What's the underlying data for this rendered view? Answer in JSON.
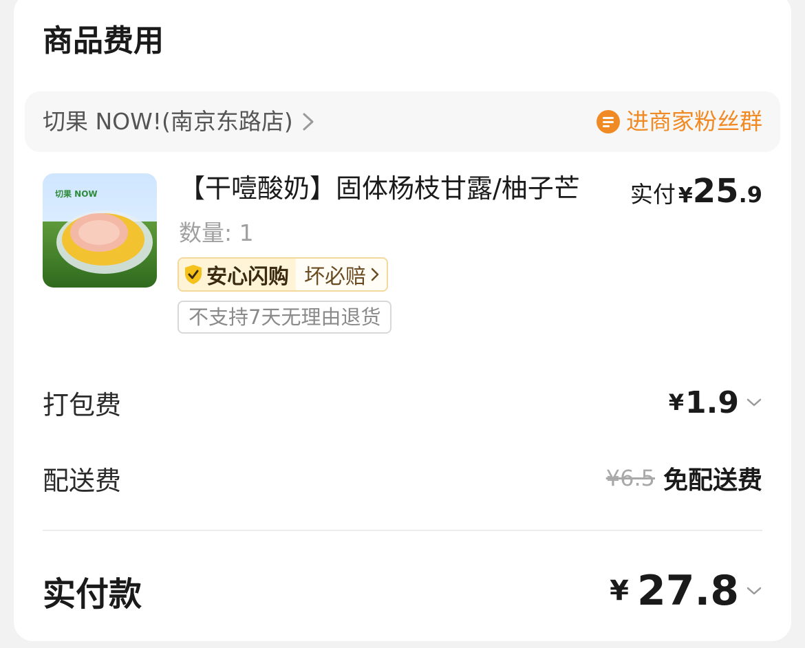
{
  "section": {
    "title": "商品费用"
  },
  "store": {
    "name": "切果 NOW!(南京东路店)",
    "fan_group_label": "进商家粉丝群",
    "fan_group_color": "#f08a24"
  },
  "product": {
    "image_label": "切果 NOW",
    "title": "【干噎酸奶】固体杨枝甘露/柚子芒",
    "paid_label": "实付",
    "paid_currency": "¥",
    "paid_int": "25",
    "paid_dec": ".9",
    "quantity_text": "数量: 1",
    "guarantee_main": "安心闪购",
    "guarantee_sub": "坏必赔",
    "no_return_tag": "不支持7天无理由退货"
  },
  "fees": {
    "packing_label": "打包费",
    "packing_currency": "¥",
    "packing_value": "1.9",
    "delivery_label": "配送费",
    "delivery_original": "¥6.5",
    "delivery_value": "免配送费"
  },
  "total": {
    "label": "实付款",
    "currency": "¥",
    "value": "27.8"
  },
  "icons": {
    "store_chevron": "chevron-right-icon",
    "fan_group": "chat-bubble-icon",
    "guarantee": "shield-check-icon",
    "dropdown": "chevron-down-icon"
  }
}
